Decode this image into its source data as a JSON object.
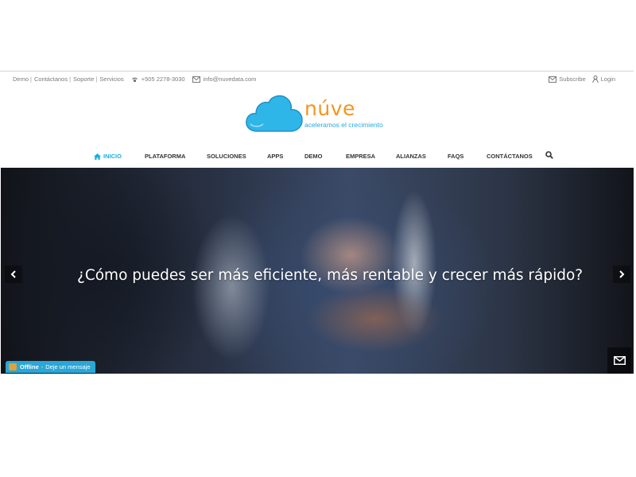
{
  "topbar": {
    "links": [
      "Demo",
      "Contáctanos",
      "Soporte",
      "Servicios"
    ],
    "separator": "|",
    "phone": "+505 2278-3030",
    "email": "info@nuvedata.com",
    "subscribe": "Subscribe",
    "login": "Login"
  },
  "brand": {
    "name": "núve",
    "tagline": "aceleramos el crecimiento",
    "cloud_color": "#2fb6e9",
    "name_color": "#f39521"
  },
  "nav": {
    "items": [
      "INICIO",
      "PLATAFORMA",
      "SOLUCIONES",
      "APPS",
      "DEMO",
      "EMPRESA",
      "ALIANZAS",
      "FAQS",
      "CONTÁCTANOS"
    ],
    "active": "INICIO",
    "accent_color": "#18aee0"
  },
  "hero": {
    "headline": "¿Cómo puedes ser más eficiente, más rentable y crecer más rápido?"
  },
  "chat": {
    "status": "Offline",
    "separator": "-",
    "message": "Deje un mensaje"
  },
  "icons": {
    "phone": "phone-icon",
    "email": "envelope-icon",
    "login": "user-icon",
    "home": "home-icon",
    "search": "search-icon",
    "prev": "chevron-left-icon",
    "next": "chevron-right-icon",
    "mail": "envelope-icon"
  }
}
